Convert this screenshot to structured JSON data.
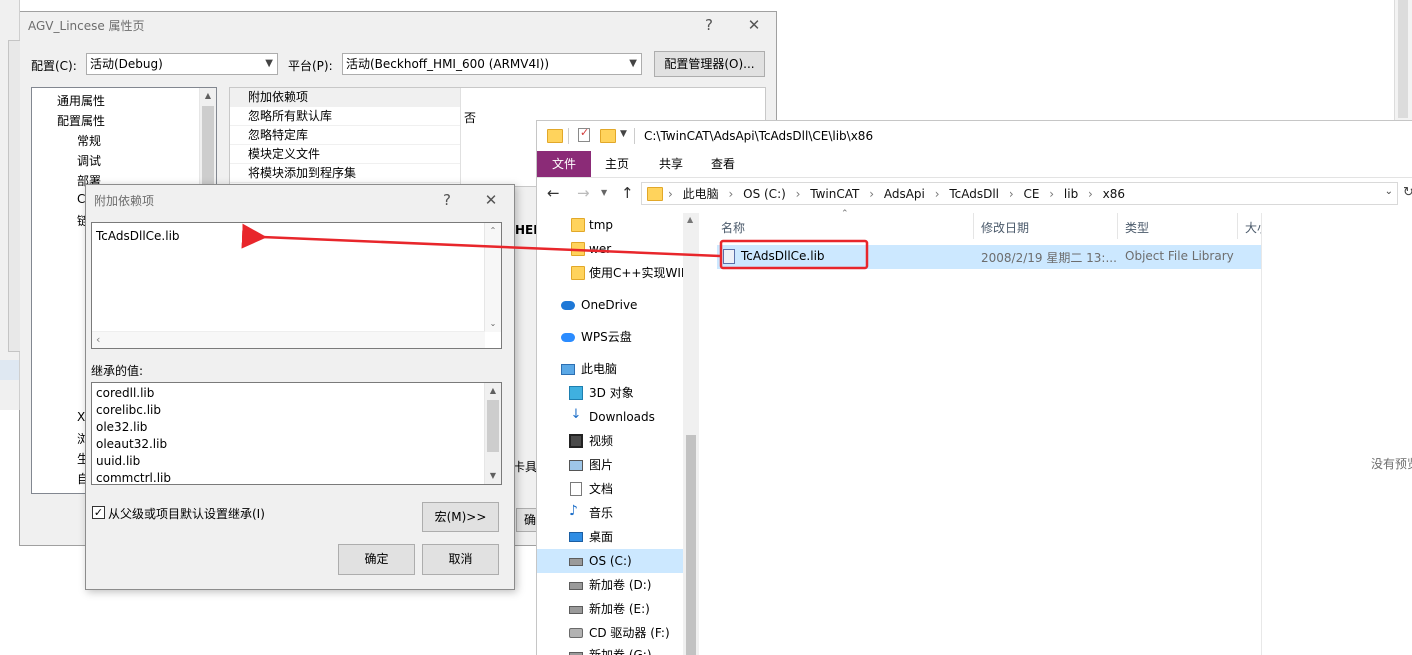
{
  "prop_dialog": {
    "title": "AGV_Lincese 属性页",
    "help_glyph": "?",
    "close_glyph": "✕",
    "config_label": "配置(C):",
    "config_value": "活动(Debug)",
    "platform_label": "平台(P):",
    "platform_value": "活动(Beckhoff_HMI_600 (ARMV4I))",
    "config_manager_label": "配置管理器(O)...",
    "tree": [
      "通用属性",
      "配置属性",
      "常规",
      "调试",
      "部署",
      "C",
      "链"
    ],
    "tree_lower": [
      "XI",
      "浏",
      "生",
      "自"
    ],
    "properties": [
      {
        "name": "附加依赖项",
        "value": ""
      },
      {
        "name": "忽略所有默认库",
        "value": "否"
      },
      {
        "name": "忽略特定库",
        "value": ""
      },
      {
        "name": "模块定义文件",
        "value": ""
      },
      {
        "name": "将模块添加到程序集",
        "value": ""
      }
    ],
    "partial_text_her": "HER",
    "partial_text_tools": "卡具",
    "partial_ok": "确"
  },
  "dep_dialog": {
    "title": "附加依赖项",
    "help_glyph": "?",
    "close_glyph": "✕",
    "edit_value": "TcAdsDllCe.lib",
    "inherited_label": "继承的值:",
    "inherited_values": [
      "coredll.lib",
      "corelibc.lib",
      "ole32.lib",
      "oleaut32.lib",
      "uuid.lib",
      "commctrl.lib"
    ],
    "inherit_checkbox_label": "从父级或项目默认设置继承(I)",
    "inherit_checked": true,
    "macro_button": "宏(M)>>",
    "ok_button": "确定",
    "cancel_button": "取消"
  },
  "explorer": {
    "title_path": "C:\\TwinCAT\\AdsApi\\TcAdsDll\\CE\\lib\\x86",
    "ribbon_tabs": [
      "文件",
      "主页",
      "共享",
      "查看"
    ],
    "active_tab_color": "#8b2b77",
    "breadcrumb": [
      "此电脑",
      "OS (C:)",
      "TwinCAT",
      "AdsApi",
      "TcAdsDll",
      "CE",
      "lib",
      "x86"
    ],
    "nav": [
      {
        "label": "tmp",
        "icon": "folder-icon"
      },
      {
        "label": "wer",
        "icon": "folder-icon"
      },
      {
        "label": "使用C++实现WIN",
        "icon": "folder-icon"
      },
      {
        "label": "OneDrive",
        "icon": "cloud-icon"
      },
      {
        "label": "WPS云盘",
        "icon": "cloud-icon"
      },
      {
        "label": "此电脑",
        "icon": "pc-icon"
      },
      {
        "label": "3D 对象",
        "icon": "cube-icon"
      },
      {
        "label": "Downloads",
        "icon": "download-icon"
      },
      {
        "label": "视频",
        "icon": "video-icon"
      },
      {
        "label": "图片",
        "icon": "picture-icon"
      },
      {
        "label": "文档",
        "icon": "document-icon"
      },
      {
        "label": "音乐",
        "icon": "music-icon"
      },
      {
        "label": "桌面",
        "icon": "desktop-icon"
      },
      {
        "label": "OS (C:)",
        "icon": "drive-icon"
      },
      {
        "label": "新加卷 (D:)",
        "icon": "drive-icon"
      },
      {
        "label": "新加卷 (E:)",
        "icon": "drive-icon"
      },
      {
        "label": "CD 驱动器 (F:)",
        "icon": "cd-icon"
      },
      {
        "label": "新加卷 (G:)",
        "icon": "drive-icon"
      }
    ],
    "columns": [
      "名称",
      "修改日期",
      "类型",
      "大小"
    ],
    "file": {
      "name": "TcAdsDllCe.lib",
      "date": "2008/2/19 星期二 13:...",
      "type": "Object File Library"
    },
    "preview_text": "没有预览"
  },
  "annotation": {
    "color": "#e8262b"
  }
}
